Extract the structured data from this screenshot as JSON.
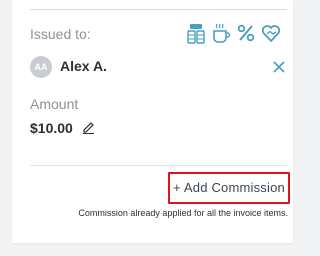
{
  "issued_to": {
    "label": "Issued to:",
    "service_icons": [
      "money-stack-icon",
      "coffee-cup-icon",
      "percent-icon",
      "heart-hands-icon"
    ]
  },
  "client": {
    "initials": "AA",
    "name": "Alex A."
  },
  "amount": {
    "label": "Amount",
    "value": "$10.00"
  },
  "commission": {
    "add_button_label": "+ Add Commission",
    "note": "Commission already applied for all the invoice items."
  },
  "colors": {
    "accent": "#4a9fc0",
    "highlight_border": "#e0141b"
  }
}
